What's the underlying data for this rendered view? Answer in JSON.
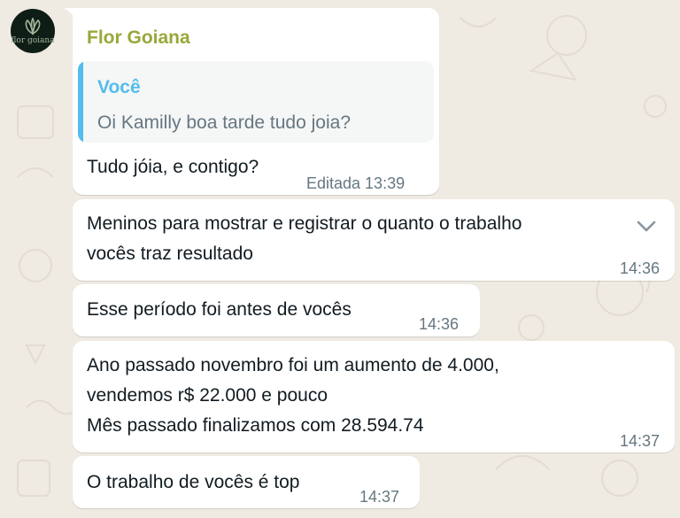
{
  "chat": {
    "sender": "Flor Goiana",
    "avatar_text": "flor goiana",
    "messages": [
      {
        "quoted_author": "Você",
        "quoted_text": "Oi Kamilly boa tarde tudo joia?",
        "text": "Tudo jóia, e contigo?",
        "time": "Editada 13:39"
      },
      {
        "lines": [
          "Meninos para mostrar e registrar o quanto o trabalho",
          "vocês traz resultado"
        ],
        "time": "14:36"
      },
      {
        "text": "Esse período foi antes de vocês",
        "time": "14:36"
      },
      {
        "lines": [
          "Ano passado novembro foi um aumento de 4.000,",
          "vendemos r$ 22.000 e pouco",
          "Mês passado finalizamos com 28.594.74"
        ],
        "time": "14:37"
      },
      {
        "text": "O trabalho de vocês é top",
        "time": "14:37"
      }
    ]
  },
  "colors": {
    "background": "#efeae2",
    "sender_name": "#9aa73a",
    "quote_accent": "#53bdeb",
    "meta_text": "#667781"
  }
}
